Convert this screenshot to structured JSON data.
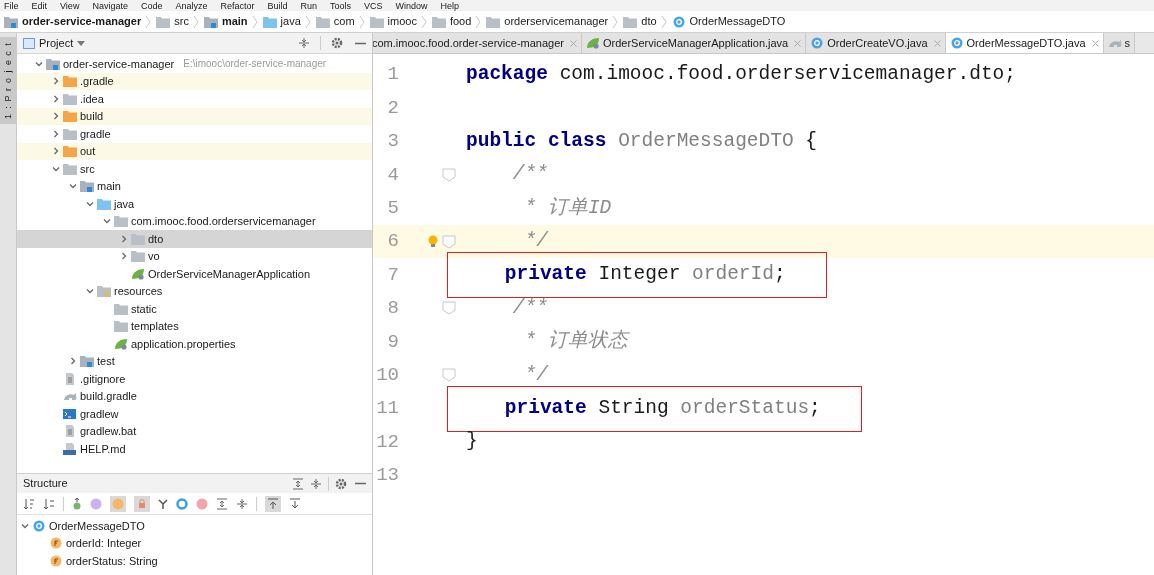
{
  "menu": [
    "File",
    "Edit",
    "View",
    "Navigate",
    "Code",
    "Analyze",
    "Refactor",
    "Build",
    "Run",
    "Tools",
    "VCS",
    "Window",
    "Help"
  ],
  "breadcrumbs": [
    {
      "label": "order-service-manager",
      "kind": "module",
      "bold": true
    },
    {
      "label": "src",
      "kind": "folder",
      "bold": false
    },
    {
      "label": "main",
      "kind": "module",
      "bold": true
    },
    {
      "label": "java",
      "kind": "source",
      "bold": false
    },
    {
      "label": "com",
      "kind": "folder",
      "bold": false
    },
    {
      "label": "imooc",
      "kind": "folder",
      "bold": false
    },
    {
      "label": "food",
      "kind": "folder",
      "bold": false
    },
    {
      "label": "orderservicemanager",
      "kind": "folder",
      "bold": false
    },
    {
      "label": "dto",
      "kind": "folder",
      "bold": false
    },
    {
      "label": "OrderMessageDTO",
      "kind": "class",
      "bold": false
    }
  ],
  "side_tab": "1: Project",
  "project_panel": {
    "title": "Project",
    "tree": [
      {
        "label": "order-service-manager",
        "hint": "E:\\imooc\\order-service-manager",
        "kind": "module",
        "expanded": true,
        "selected": false,
        "excluded": false,
        "children": [
          {
            "label": ".gradle",
            "kind": "excluded",
            "expanded": false,
            "selected": false,
            "excluded": true
          },
          {
            "label": ".idea",
            "kind": "folder",
            "expanded": false,
            "selected": false,
            "excluded": false
          },
          {
            "label": "build",
            "kind": "excluded",
            "expanded": false,
            "selected": false,
            "excluded": true
          },
          {
            "label": "gradle",
            "kind": "folder",
            "expanded": false,
            "selected": false,
            "excluded": false
          },
          {
            "label": "out",
            "kind": "excluded",
            "expanded": false,
            "selected": false,
            "excluded": true
          },
          {
            "label": "src",
            "kind": "folder",
            "expanded": true,
            "selected": false,
            "excluded": false,
            "children": [
              {
                "label": "main",
                "kind": "module",
                "expanded": true,
                "selected": false,
                "excluded": false,
                "children": [
                  {
                    "label": "java",
                    "kind": "source",
                    "expanded": true,
                    "selected": false,
                    "excluded": false,
                    "children": [
                      {
                        "label": "com.imooc.food.orderservicemanager",
                        "kind": "folder",
                        "expanded": true,
                        "selected": false,
                        "excluded": false,
                        "children": [
                          {
                            "label": "dto",
                            "kind": "folder",
                            "expanded": false,
                            "selected": true,
                            "excluded": false
                          },
                          {
                            "label": "vo",
                            "kind": "folder",
                            "expanded": false,
                            "selected": false,
                            "excluded": false
                          },
                          {
                            "label": "OrderServiceManagerApplication",
                            "kind": "spring",
                            "selected": false,
                            "excluded": false
                          }
                        ]
                      }
                    ]
                  },
                  {
                    "label": "resources",
                    "kind": "resources",
                    "expanded": true,
                    "selected": false,
                    "excluded": false,
                    "children": [
                      {
                        "label": "static",
                        "kind": "folder",
                        "selected": false,
                        "excluded": false
                      },
                      {
                        "label": "templates",
                        "kind": "folder",
                        "selected": false,
                        "excluded": false
                      },
                      {
                        "label": "application.properties",
                        "kind": "spring",
                        "selected": false,
                        "excluded": false
                      }
                    ]
                  }
                ]
              },
              {
                "label": "test",
                "kind": "module",
                "expanded": false,
                "selected": false,
                "excluded": false
              }
            ]
          },
          {
            "label": ".gitignore",
            "kind": "text",
            "selected": false,
            "excluded": false
          },
          {
            "label": "build.gradle",
            "kind": "gradle",
            "selected": false,
            "excluded": false
          },
          {
            "label": "gradlew",
            "kind": "terminal",
            "selected": false,
            "excluded": false
          },
          {
            "label": "gradlew.bat",
            "kind": "text",
            "selected": false,
            "excluded": false
          },
          {
            "label": "HELP.md",
            "kind": "markdown",
            "selected": false,
            "excluded": false
          }
        ]
      }
    ]
  },
  "structure_panel": {
    "title": "Structure",
    "tree": [
      {
        "label": "OrderMessageDTO",
        "kind": "class",
        "expanded": true,
        "children": [
          {
            "label": "orderId: Integer",
            "kind": "field"
          },
          {
            "label": "orderStatus: String",
            "kind": "field"
          }
        ]
      }
    ]
  },
  "editor_tabs": [
    {
      "label": "com.imooc.food.order-service-manager",
      "kind": "gradle",
      "selected": false
    },
    {
      "label": "OrderServiceManagerApplication.java",
      "kind": "spring",
      "selected": false
    },
    {
      "label": "OrderCreateVO.java",
      "kind": "class",
      "selected": false
    },
    {
      "label": "OrderMessageDTO.java",
      "kind": "class",
      "selected": true
    },
    {
      "label": "s",
      "kind": "gradle",
      "selected": false
    }
  ],
  "code": [
    {
      "number": "1",
      "current": false,
      "boxed": false,
      "fold": false,
      "bulb": false,
      "tokens": [
        {
          "kind": "keyword",
          "text": "package "
        },
        {
          "kind": "plain",
          "text": "com.imooc.food.orderservicemanager.dto;"
        }
      ]
    },
    {
      "number": "2",
      "current": false,
      "boxed": false,
      "fold": false,
      "bulb": false
    },
    {
      "number": "3",
      "current": false,
      "boxed": false,
      "fold": false,
      "bulb": false,
      "tokens": [
        {
          "kind": "keyword",
          "text": "public class "
        },
        {
          "kind": "unused",
          "text": "OrderMessageDTO"
        },
        {
          "kind": "plain",
          "text": " {"
        }
      ]
    },
    {
      "number": "4",
      "current": false,
      "boxed": false,
      "fold": true,
      "bulb": false,
      "tokens": [
        {
          "kind": "comment",
          "text": "    /**"
        }
      ]
    },
    {
      "number": "5",
      "current": false,
      "boxed": false,
      "fold": false,
      "bulb": false,
      "tokens": [
        {
          "kind": "comment",
          "text": "     * 订单ID"
        }
      ]
    },
    {
      "number": "6",
      "current": true,
      "boxed": false,
      "fold": true,
      "bulb": true,
      "tokens": [
        {
          "kind": "comment",
          "text": "     */"
        }
      ]
    },
    {
      "number": "7",
      "current": false,
      "boxed": true,
      "fold": false,
      "bulb": false,
      "tokens": [
        {
          "kind": "keyword",
          "text": "    private "
        },
        {
          "kind": "plain",
          "text": "Integer "
        },
        {
          "kind": "unused",
          "text": "orderId"
        },
        {
          "kind": "plain",
          "text": ";"
        }
      ]
    },
    {
      "number": "8",
      "current": false,
      "boxed": false,
      "fold": true,
      "bulb": false,
      "tokens": [
        {
          "kind": "comment",
          "text": "    /**"
        }
      ]
    },
    {
      "number": "9",
      "current": false,
      "boxed": false,
      "fold": false,
      "bulb": false,
      "tokens": [
        {
          "kind": "comment",
          "text": "     * 订单状态"
        }
      ]
    },
    {
      "number": "10",
      "current": false,
      "boxed": false,
      "fold": true,
      "bulb": false,
      "tokens": [
        {
          "kind": "comment",
          "text": "     */"
        }
      ]
    },
    {
      "number": "11",
      "current": false,
      "boxed": true,
      "fold": false,
      "bulb": false,
      "tokens": [
        {
          "kind": "keyword",
          "text": "    private "
        },
        {
          "kind": "plain",
          "text": "String "
        },
        {
          "kind": "unused",
          "text": "orderStatus"
        },
        {
          "kind": "plain",
          "text": ";"
        }
      ]
    },
    {
      "number": "12",
      "current": false,
      "boxed": false,
      "fold": false,
      "bulb": false,
      "tokens": [
        {
          "kind": "plain",
          "text": "}"
        }
      ]
    },
    {
      "number": "13",
      "current": false,
      "boxed": false,
      "fold": false,
      "bulb": false
    }
  ]
}
